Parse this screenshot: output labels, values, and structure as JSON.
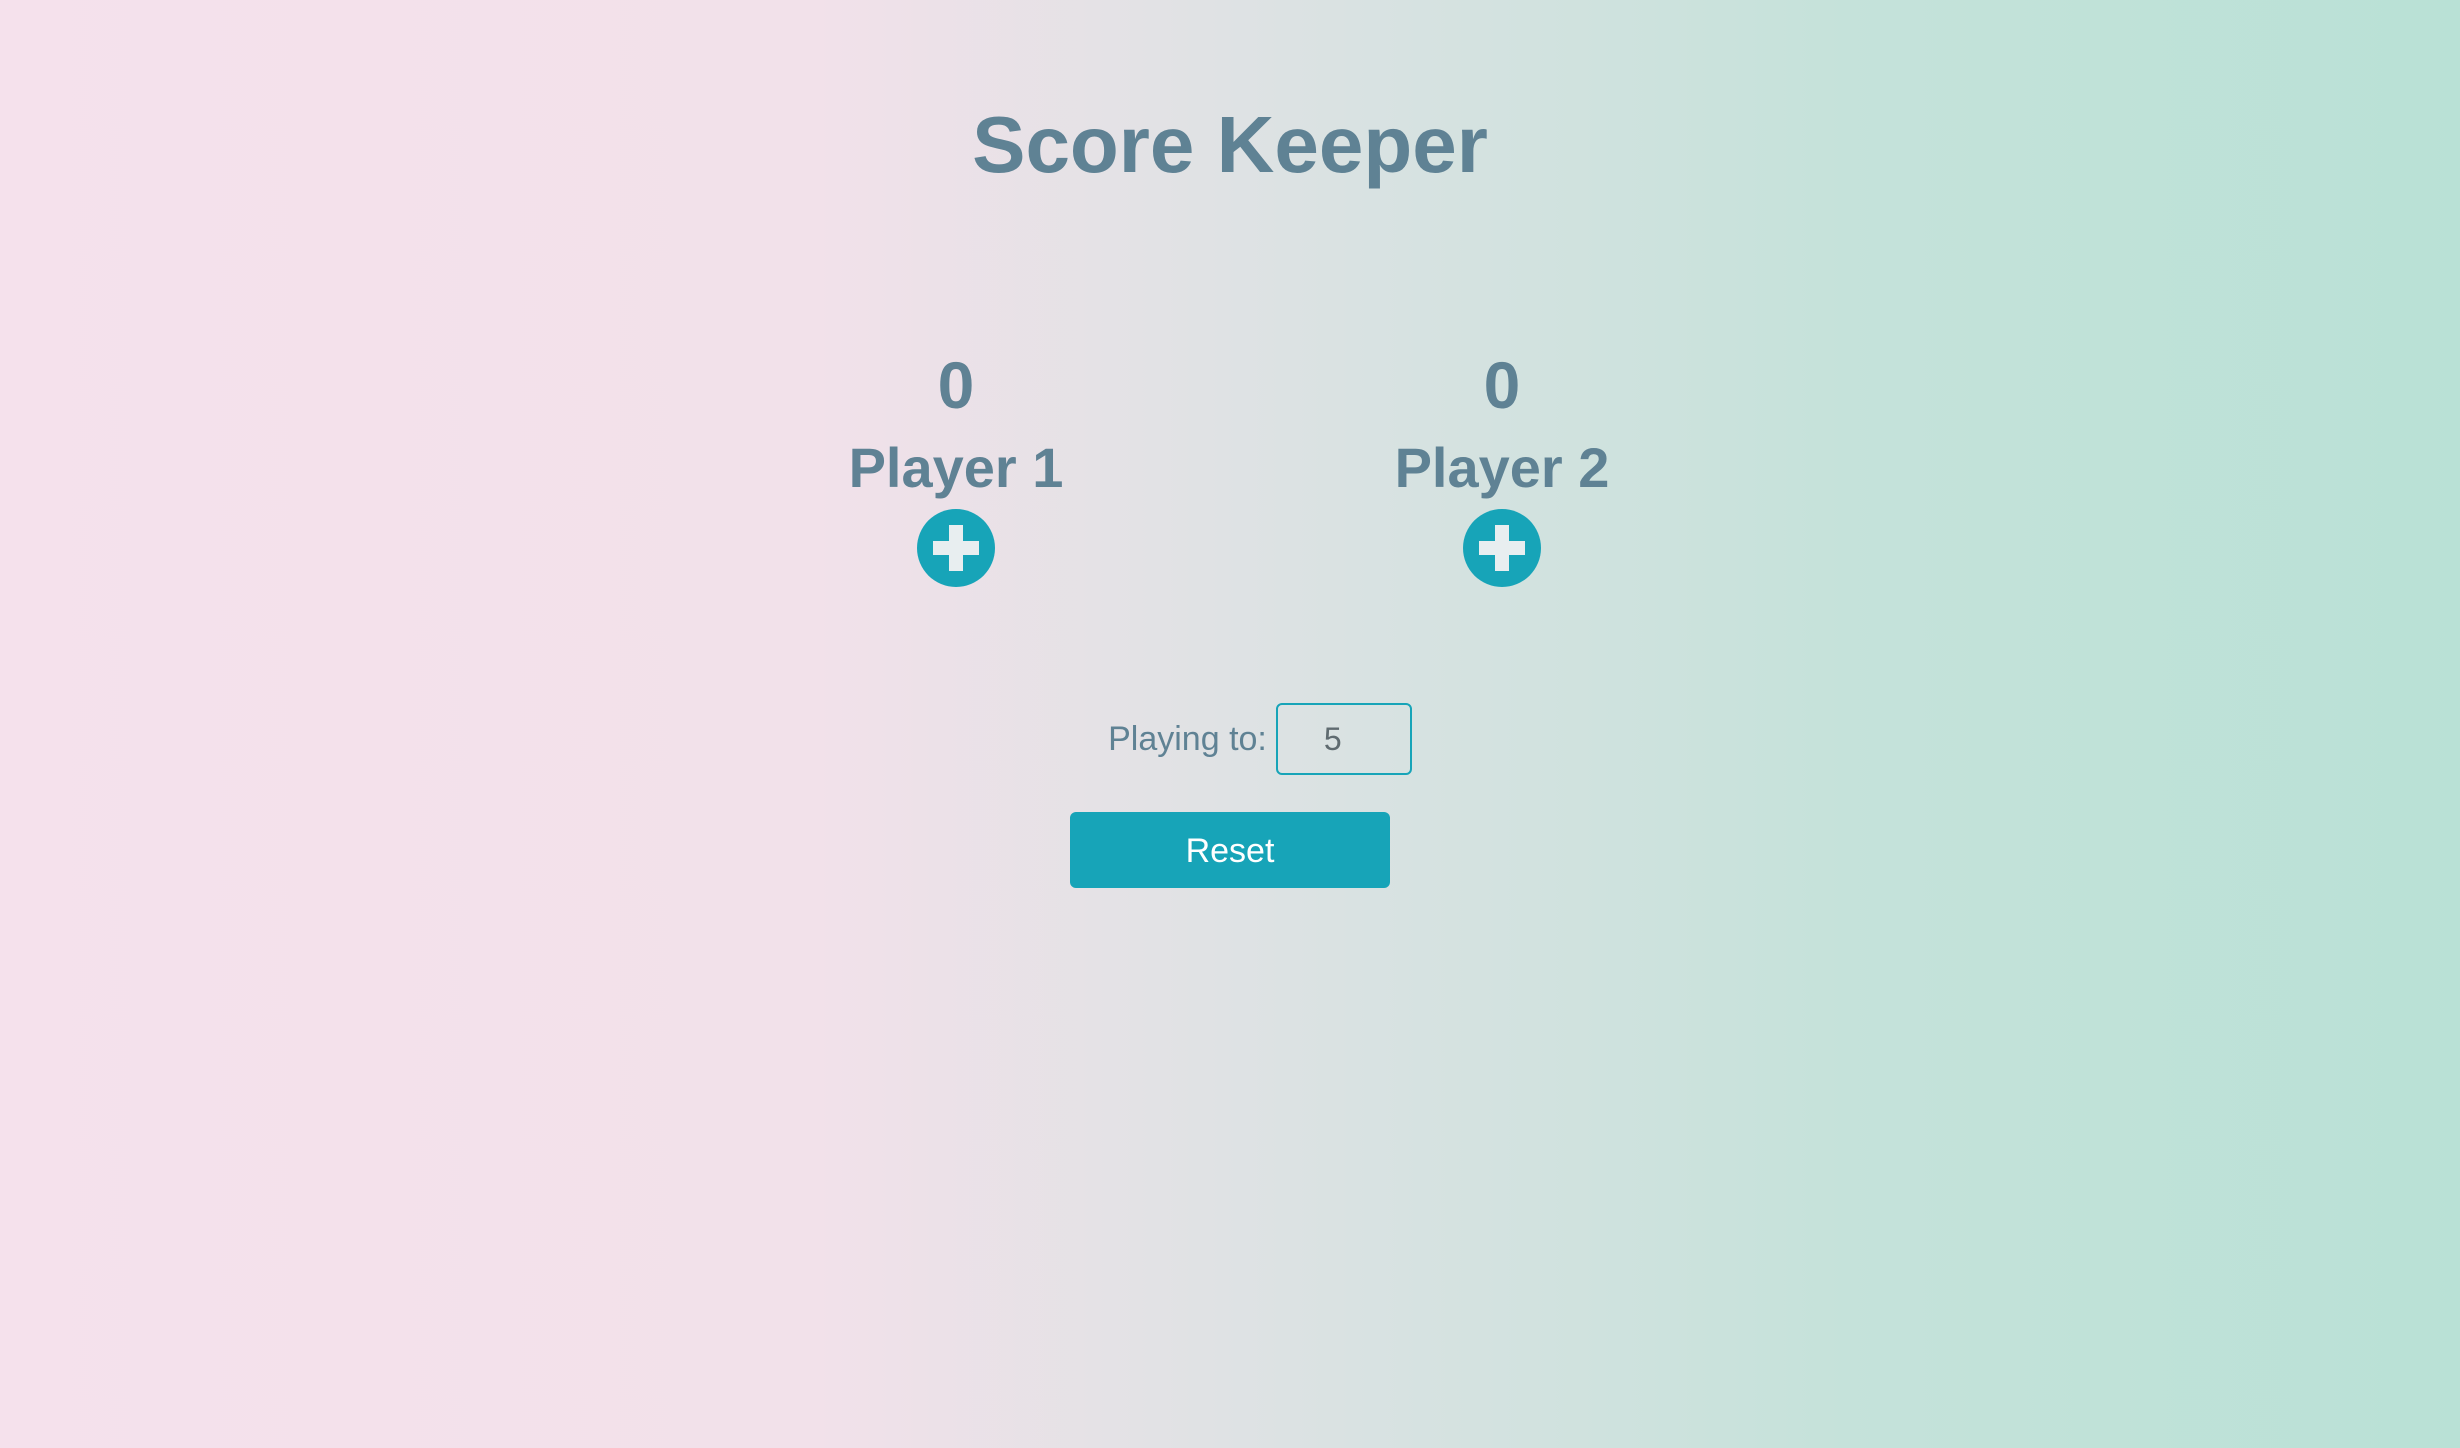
{
  "app": {
    "title": "Score Keeper"
  },
  "players": [
    {
      "score": "0",
      "name": "Player 1",
      "add_icon": "plus-circle-icon"
    },
    {
      "score": "0",
      "name": "Player 2",
      "add_icon": "plus-circle-icon"
    }
  ],
  "settings": {
    "playing_to_label": "Playing to:",
    "playing_to_value": "5"
  },
  "controls": {
    "reset_label": "Reset"
  },
  "colors": {
    "accent": "#17a4b8",
    "text": "#5f8294",
    "gradient_left": "#f5e1ec",
    "gradient_right": "#b9e1d6"
  }
}
